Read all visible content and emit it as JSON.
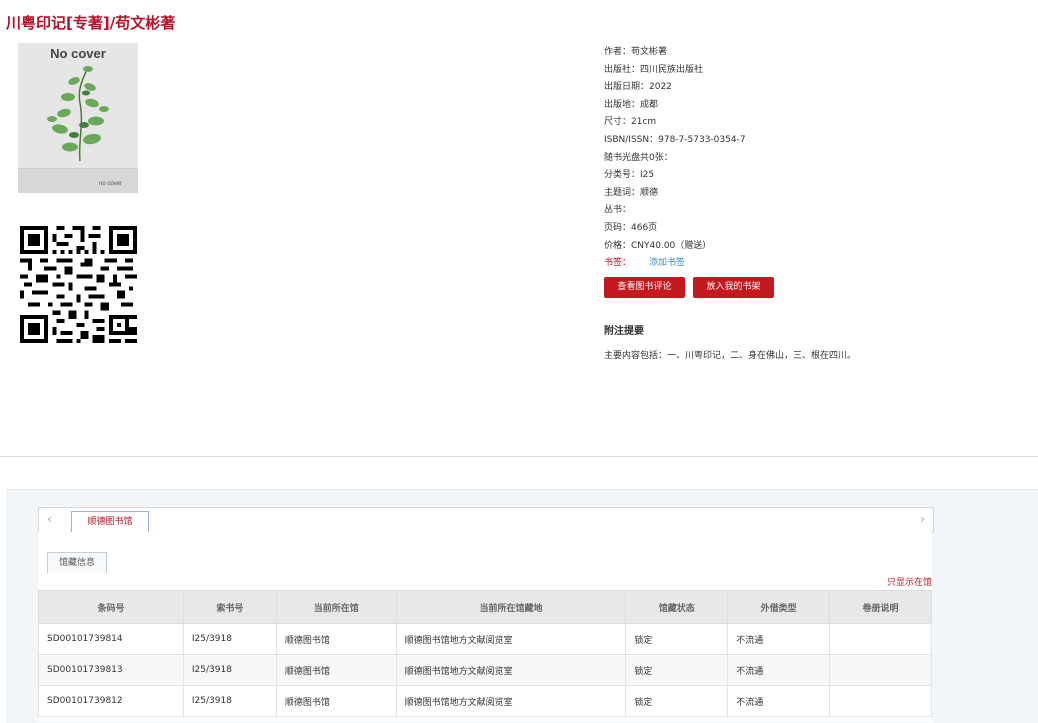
{
  "book": {
    "title": "川粤印记[专著]/苟文彬著",
    "cover": {
      "main_text": "No cover",
      "small_text": "no cover"
    }
  },
  "info": {
    "author": "作者：苟文彬著",
    "publisher": "出版社：四川民族出版社",
    "pub_date": "出版日期：2022",
    "pub_place": "出版地：成都",
    "size": "尺寸：21cm",
    "isbn": "ISBN/ISSN：978-7-5733-0354-7",
    "cd": "随书光盘共0张：",
    "class_no": "分类号：I25",
    "subject": "主题词：顺德",
    "series": "丛书：",
    "pages": "页码：466页",
    "price": "价格：CNY40.00（赠送）",
    "bookmark_label": "书签：",
    "bookmark_link": "添加书签"
  },
  "buttons": {
    "review": "查看图书评论",
    "shelf": "放入我的书架"
  },
  "note": {
    "heading": "附注提要",
    "text": "主要内容包括：一、川粤印记，二、身在佛山，三、根在四川。"
  },
  "holdings": {
    "library_tab": "顺德图书馆",
    "sub_tab": "馆藏信息",
    "only_this": "只显示在馆",
    "columns": [
      "条码号",
      "索书号",
      "当前所在馆",
      "当前所在馆藏地",
      "馆藏状态",
      "外借类型",
      "卷册说明"
    ],
    "rows": [
      [
        "SD00101739814",
        "I25/3918",
        "顺德图书馆",
        "顺德图书馆地方文献阅览室",
        "锁定",
        "不流通",
        ""
      ],
      [
        "SD00101739813",
        "I25/3918",
        "顺德图书馆",
        "顺德图书馆地方文献阅览室",
        "锁定",
        "不流通",
        ""
      ],
      [
        "SD00101739812",
        "I25/3918",
        "顺德图书馆",
        "顺德图书馆地方文献阅览室",
        "锁定",
        "不流通",
        ""
      ]
    ]
  },
  "icons": {
    "prev": "chevron-left-icon",
    "next": "chevron-right-icon"
  },
  "colors": {
    "title": "#b3122a",
    "button": "#c41a1f",
    "link": "#3a8cc7"
  }
}
